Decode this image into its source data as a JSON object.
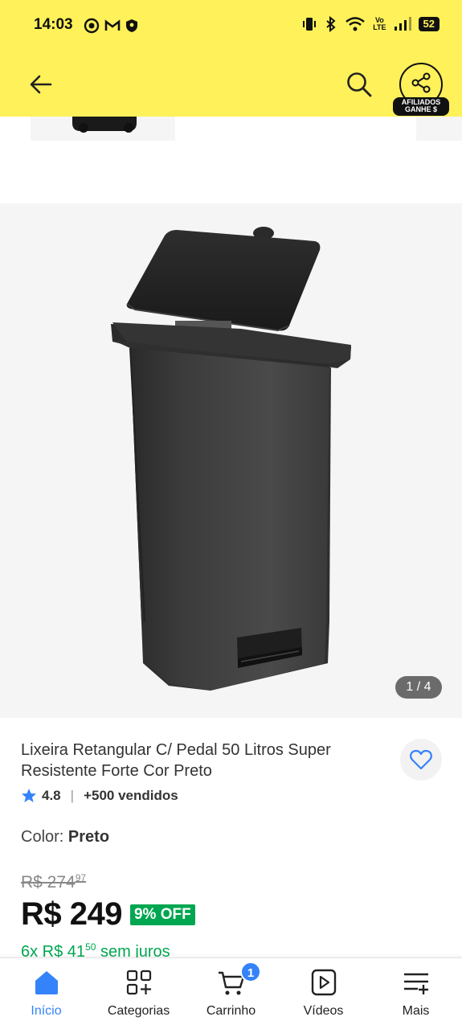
{
  "status_bar": {
    "time": "14:03",
    "battery": "52",
    "network": "Vo LTE",
    "icons": [
      "target-icon",
      "gmail-icon",
      "shield-icon",
      "vibrate-icon",
      "bluetooth-icon",
      "wifi-icon",
      "signal-icon"
    ]
  },
  "header": {
    "back_icon": "arrow-left-icon",
    "search_icon": "search-icon",
    "share_icon": "share-icon",
    "affiliate_line1": "AFILIADOS",
    "affiliate_line2": "GANHE $",
    "bg_color": "#fff159"
  },
  "gallery": {
    "counter": "1 / 4",
    "image": "black-step-trash-bin-image"
  },
  "product": {
    "title": "Lixeira Retangular C/ Pedal 50 Litros Super Resistente Forte Cor Preto",
    "rating": "4.8",
    "sold": "+500 vendidos",
    "color_label": "Color:",
    "color_value": "Preto",
    "old_price_main": "R$ 274",
    "old_price_cents": "97",
    "price": "R$ 249",
    "discount": "9% OFF",
    "installments_prefix": "6x R$ 41",
    "installments_cents": "50",
    "installments_suffix": "sem juros",
    "accent_green": "#00a650"
  },
  "bottom_nav": {
    "accent": "#3483fa",
    "items": [
      {
        "label": "Início",
        "icon": "home-icon",
        "active": true
      },
      {
        "label": "Categorias",
        "icon": "categories-icon"
      },
      {
        "label": "Carrinho",
        "icon": "cart-icon",
        "badge": "1"
      },
      {
        "label": "Vídeos",
        "icon": "video-icon"
      },
      {
        "label": "Mais",
        "icon": "menu-plus-icon"
      }
    ]
  }
}
